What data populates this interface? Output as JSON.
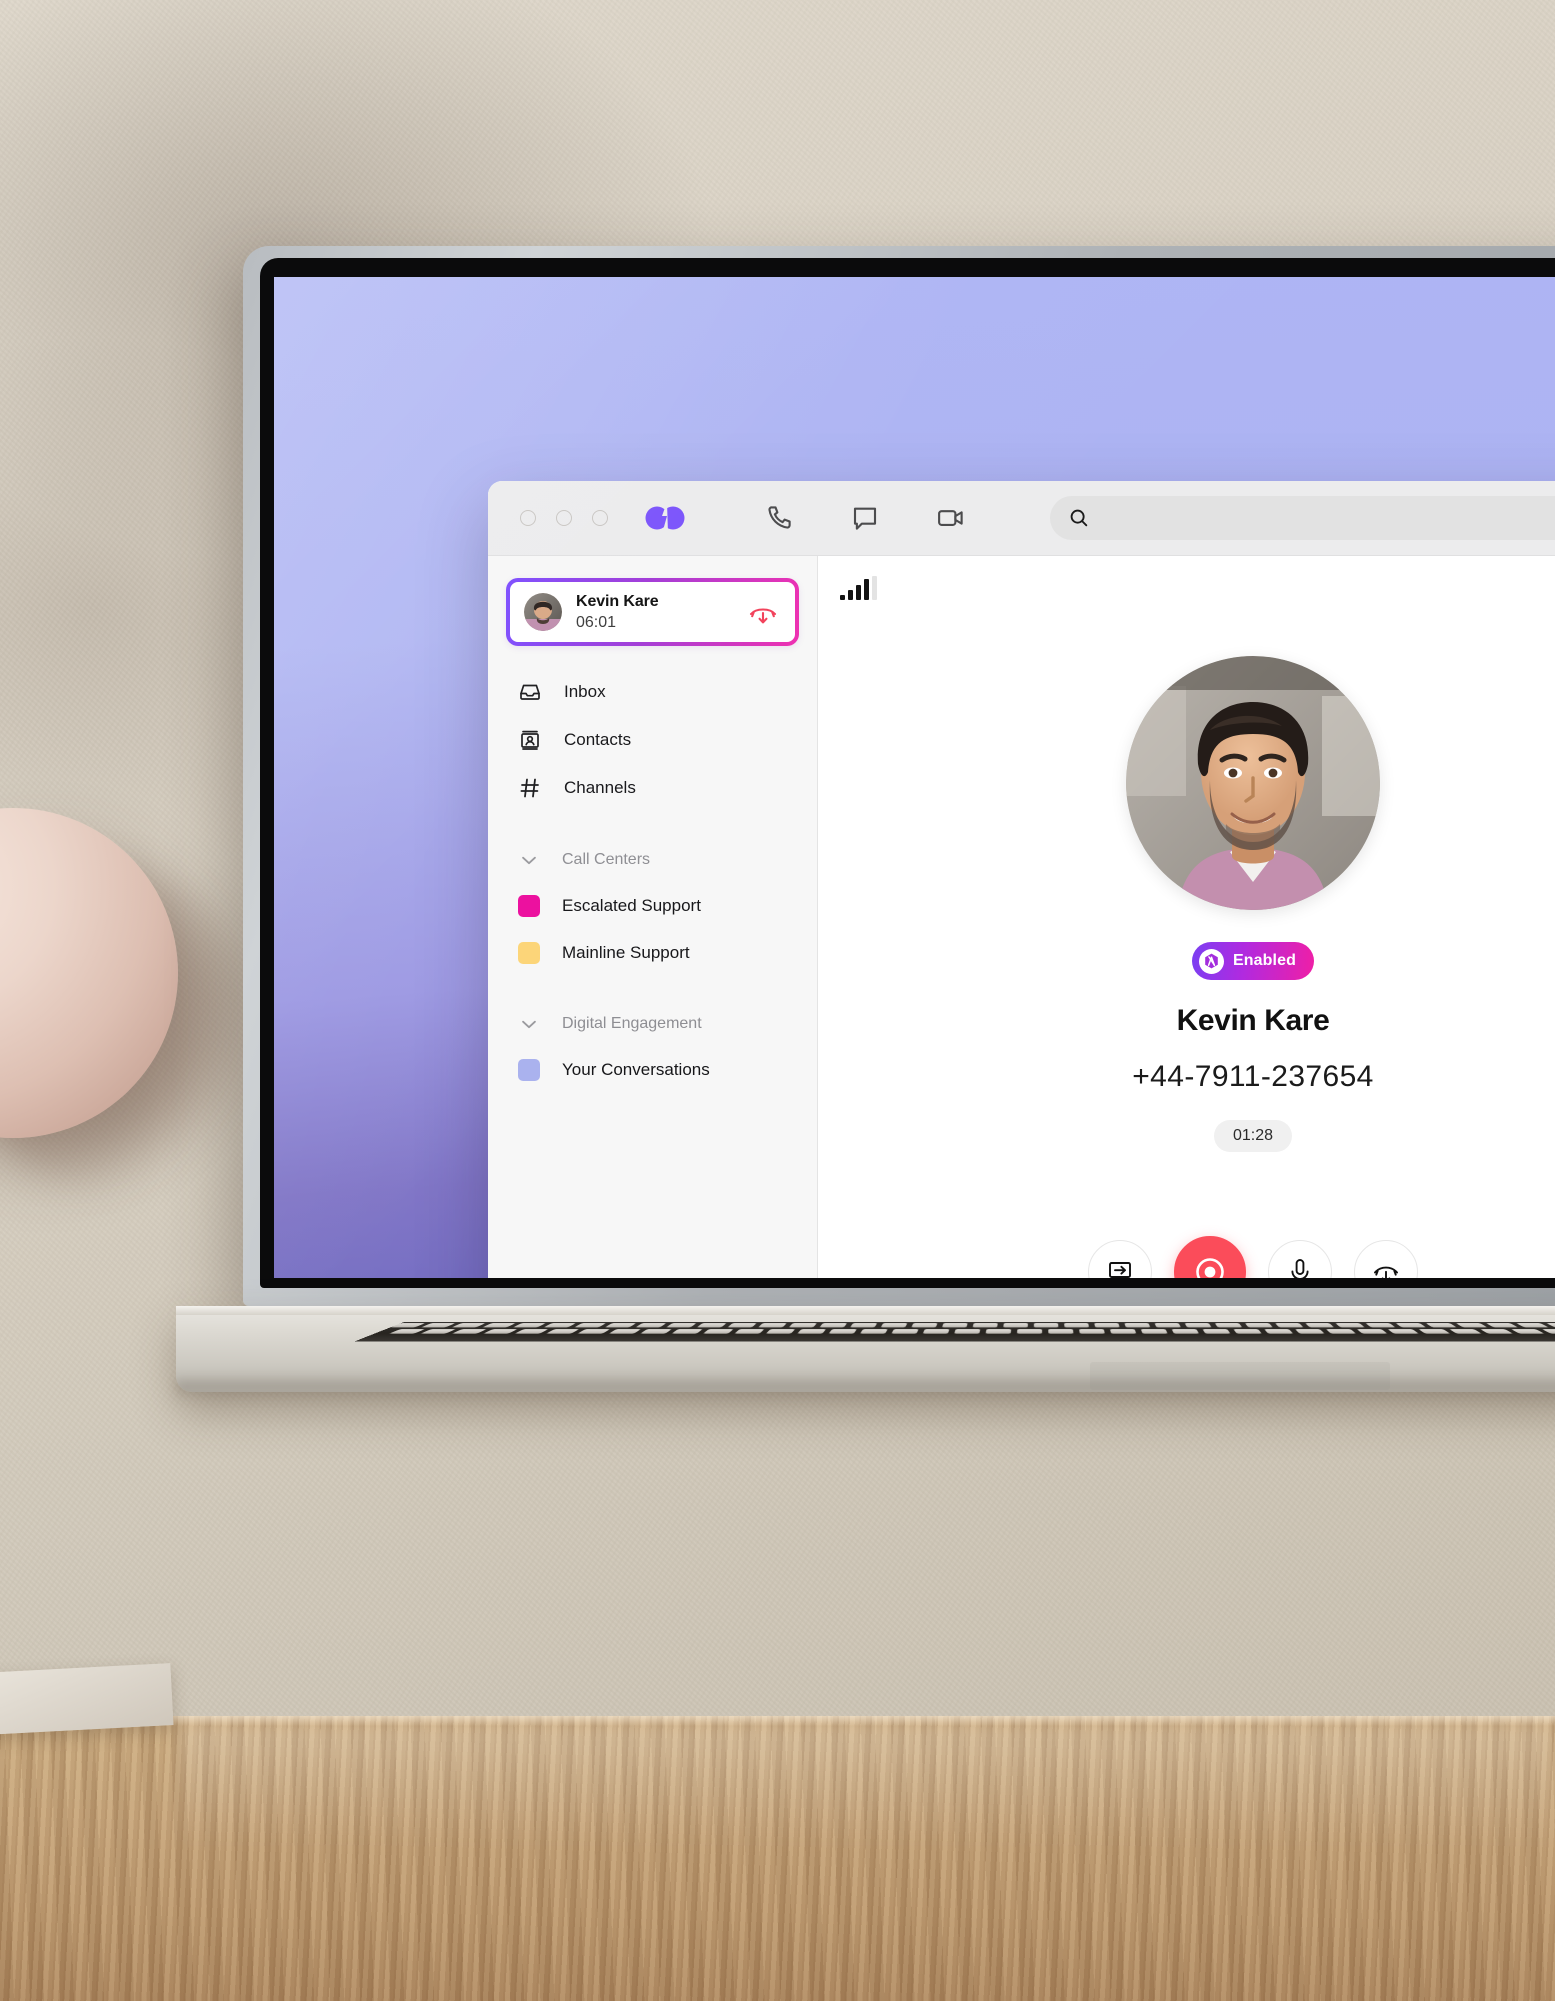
{
  "window": {
    "traffic_lights": [
      "close",
      "minimize",
      "maximize"
    ],
    "brand": "dialpad-logo",
    "header_icons": [
      {
        "name": "phone-icon",
        "label": "Calls"
      },
      {
        "name": "chat-icon",
        "label": "Messages"
      },
      {
        "name": "video-icon",
        "label": "Video"
      }
    ],
    "search": {
      "value": "",
      "placeholder": "",
      "icon": "search-icon"
    }
  },
  "sidebar": {
    "active_call": {
      "name": "Kevin Kare",
      "duration": "06:01",
      "hangup_icon": "hangup-icon",
      "avatar": "contact-avatar"
    },
    "nav": [
      {
        "label": "Inbox",
        "icon": "inbox-icon"
      },
      {
        "label": "Contacts",
        "icon": "contacts-icon"
      },
      {
        "label": "Channels",
        "icon": "hash-icon"
      }
    ],
    "sections": [
      {
        "title": "Call Centers",
        "chevron": "chevron-down-icon",
        "items": [
          {
            "label": "Escalated Support",
            "color": "#ec0f9e"
          },
          {
            "label": "Mainline Support",
            "color": "#fcd578"
          }
        ]
      },
      {
        "title": "Digital Engagement",
        "chevron": "chevron-down-icon",
        "items": [
          {
            "label": "Your Conversations",
            "color": "#aab2ee"
          }
        ]
      }
    ]
  },
  "call_panel": {
    "signal": {
      "icon": "signal-bars-icon",
      "bars_filled": 4,
      "bars_total": 5
    },
    "avatar": "caller-photo",
    "ai_badge": {
      "label": "Enabled",
      "icon": "ai-icon",
      "gradient_from": "#7b3ff2",
      "gradient_to": "#ef1fa6"
    },
    "caller_name": "Kevin Kare",
    "caller_number": "+44-7911-237654",
    "timer": "01:28",
    "controls": [
      {
        "name": "transfer-button",
        "icon": "transfer-icon",
        "label": "Transfer"
      },
      {
        "name": "record-button",
        "icon": "record-icon",
        "label": "Record",
        "color": "#fb4c5a"
      },
      {
        "name": "mute-button",
        "icon": "microphone-icon",
        "label": "Mute"
      },
      {
        "name": "end-call-button",
        "icon": "hangup-icon",
        "label": "End call"
      }
    ]
  }
}
